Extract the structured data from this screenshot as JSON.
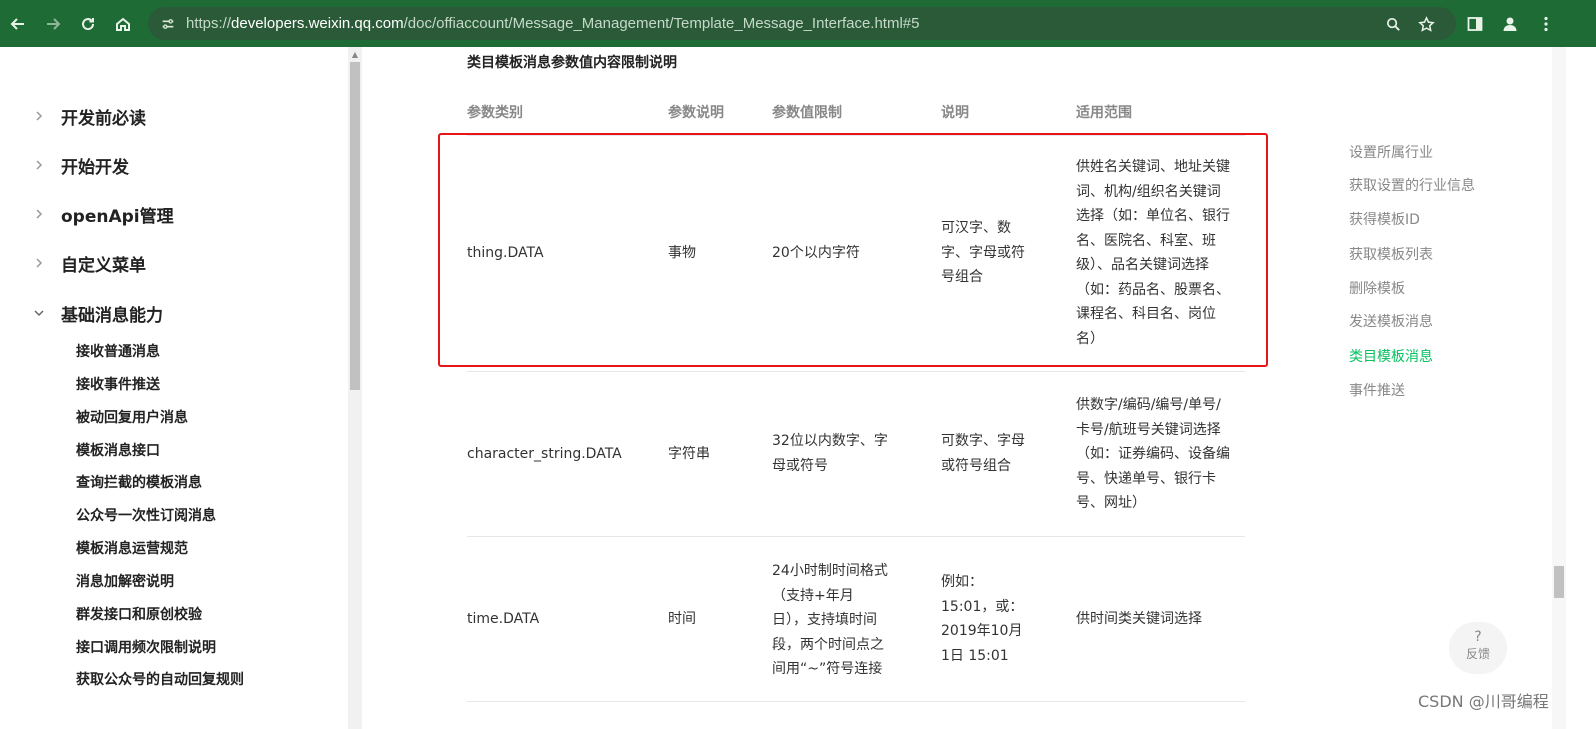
{
  "browser": {
    "url_prefix": "https://",
    "url_host": "developers.weixin.qq.com",
    "url_path": "/doc/offiaccount/Message_Management/Template_Message_Interface.html#5"
  },
  "sidebar": {
    "top_items": [
      "开发前必读",
      "开始开发",
      "openApi管理",
      "自定义菜单",
      "基础消息能力"
    ],
    "sub_items": [
      "接收普通消息",
      "接收事件推送",
      "被动回复用户消息",
      "模板消息接口",
      "查询拦截的模板消息",
      "公众号一次性订阅消息",
      "模板消息运营规范",
      "消息加解密说明",
      "群发接口和原创校验",
      "接口调用频次限制说明",
      "获取公众号的自动回复规则"
    ]
  },
  "main": {
    "section_title": "类目模板消息参数值内容限制说明",
    "headers": [
      "参数类别",
      "参数说明",
      "参数值限制",
      "说明",
      "适用范围"
    ],
    "rows": [
      {
        "type": "thing.DATA",
        "desc": "事物",
        "limit": [
          "20个以内字符"
        ],
        "note": [
          "可汉字、数",
          "字、字母或符",
          "号组合"
        ],
        "scope": [
          "供姓名关键词、地址关键",
          "词、机构/组织名关键词",
          "选择（如：单位名、银行",
          "名、医院名、科室、班",
          "级）、品名关键词选择",
          "（如：药品名、股票名、",
          "课程名、科目名、岗位",
          "名）"
        ]
      },
      {
        "type": "character_string.DATA",
        "desc": "字符串",
        "limit": [
          "32位以内数字、字",
          "母或符号"
        ],
        "note": [
          "可数字、字母",
          "或符号组合"
        ],
        "scope": [
          "供数字/编码/编号/单号/",
          "卡号/航班号关键词选择",
          "（如：证券编码、设备编",
          "号、快递单号、银行卡",
          "号、网址）"
        ]
      },
      {
        "type": "time.DATA",
        "desc": "时间",
        "limit": [
          "24小时制时间格式",
          "（支持+年月",
          "日），支持填时间",
          "段，两个时间点之",
          "间用“~”符号连接"
        ],
        "note": [
          "例如：",
          "15:01，或：",
          "2019年10月",
          "1日 15:01"
        ],
        "scope": [
          "供时间类关键词选择"
        ]
      }
    ]
  },
  "toc": {
    "items": [
      "设置所属行业",
      "获取设置的行业信息",
      "获得模板ID",
      "获取模板列表",
      "删除模板",
      "发送模板消息",
      "类目模板消息",
      "事件推送"
    ],
    "active_index": 6
  },
  "feedback": {
    "icon": "?",
    "label": "反馈"
  },
  "watermark": "CSDN @川哥编程",
  "colors": {
    "toolbar": "#1f6b35",
    "highlight": "#e5151a",
    "active": "#07c160"
  }
}
